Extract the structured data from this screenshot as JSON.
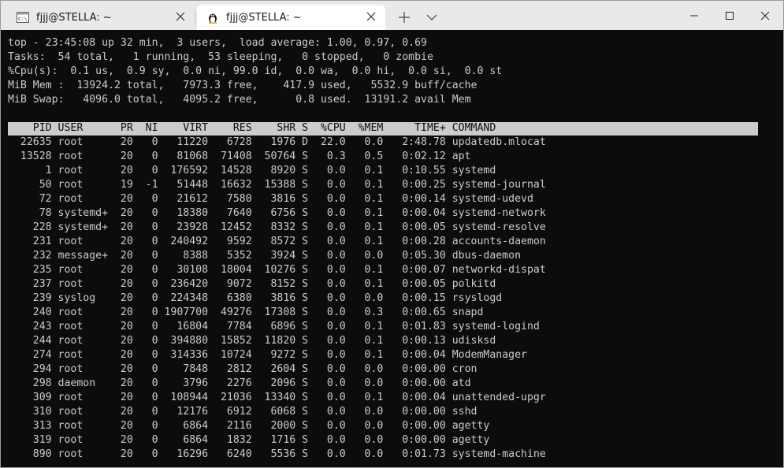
{
  "tabs": [
    {
      "title": "fjjj@STELLA: ~",
      "icon": "cmd-icon",
      "active": false
    },
    {
      "title": "fjjj@STELLA: ~",
      "icon": "linux-penguin-icon",
      "active": true
    }
  ],
  "window_controls": [
    "minimize-icon",
    "maximize-icon",
    "close-icon"
  ],
  "summary": [
    "top - 23:45:08 up 32 min,  3 users,  load average: 1.00, 0.97, 0.69",
    "Tasks:  54 total,   1 running,  53 sleeping,   0 stopped,   0 zombie",
    "%Cpu(s):  0.1 us,  0.9 sy,  0.0 ni, 99.0 id,  0.0 wa,  0.0 hi,  0.0 si,  0.0 st",
    "MiB Mem :  13924.2 total,   7973.3 free,    417.9 used,   5532.9 buff/cache",
    "MiB Swap:   4096.0 total,   4095.2 free,      0.8 used.  13191.2 avail Mem"
  ],
  "columns": [
    "PID",
    "USER",
    "PR",
    "NI",
    "VIRT",
    "RES",
    "SHR",
    "S",
    "%CPU",
    "%MEM",
    "TIME+",
    "COMMAND"
  ],
  "processes": [
    [
      "22635",
      "root",
      "20",
      "0",
      "11220",
      "6728",
      "1976",
      "D",
      "22.0",
      "0.0",
      "2:48.78",
      "updatedb.mlocat"
    ],
    [
      "13528",
      "root",
      "20",
      "0",
      "81068",
      "71408",
      "50764",
      "S",
      "0.3",
      "0.5",
      "0:02.12",
      "apt"
    ],
    [
      "1",
      "root",
      "20",
      "0",
      "176592",
      "14528",
      "8920",
      "S",
      "0.0",
      "0.1",
      "0:10.55",
      "systemd"
    ],
    [
      "50",
      "root",
      "19",
      "-1",
      "51448",
      "16632",
      "15388",
      "S",
      "0.0",
      "0.1",
      "0:00.25",
      "systemd-journal"
    ],
    [
      "72",
      "root",
      "20",
      "0",
      "21612",
      "7580",
      "3816",
      "S",
      "0.0",
      "0.1",
      "0:00.14",
      "systemd-udevd"
    ],
    [
      "78",
      "systemd+",
      "20",
      "0",
      "18380",
      "7640",
      "6756",
      "S",
      "0.0",
      "0.1",
      "0:00.04",
      "systemd-network"
    ],
    [
      "228",
      "systemd+",
      "20",
      "0",
      "23928",
      "12452",
      "8332",
      "S",
      "0.0",
      "0.1",
      "0:00.05",
      "systemd-resolve"
    ],
    [
      "231",
      "root",
      "20",
      "0",
      "240492",
      "9592",
      "8572",
      "S",
      "0.0",
      "0.1",
      "0:00.28",
      "accounts-daemon"
    ],
    [
      "232",
      "message+",
      "20",
      "0",
      "8388",
      "5352",
      "3924",
      "S",
      "0.0",
      "0.0",
      "0:05.30",
      "dbus-daemon"
    ],
    [
      "235",
      "root",
      "20",
      "0",
      "30108",
      "18004",
      "10276",
      "S",
      "0.0",
      "0.1",
      "0:00.07",
      "networkd-dispat"
    ],
    [
      "237",
      "root",
      "20",
      "0",
      "236420",
      "9072",
      "8152",
      "S",
      "0.0",
      "0.1",
      "0:00.05",
      "polkitd"
    ],
    [
      "239",
      "syslog",
      "20",
      "0",
      "224348",
      "6380",
      "3816",
      "S",
      "0.0",
      "0.0",
      "0:00.15",
      "rsyslogd"
    ],
    [
      "240",
      "root",
      "20",
      "0",
      "1907700",
      "49276",
      "17308",
      "S",
      "0.0",
      "0.3",
      "0:00.65",
      "snapd"
    ],
    [
      "243",
      "root",
      "20",
      "0",
      "16804",
      "7784",
      "6896",
      "S",
      "0.0",
      "0.1",
      "0:01.83",
      "systemd-logind"
    ],
    [
      "244",
      "root",
      "20",
      "0",
      "394880",
      "15852",
      "11820",
      "S",
      "0.0",
      "0.1",
      "0:00.13",
      "udisksd"
    ],
    [
      "274",
      "root",
      "20",
      "0",
      "314336",
      "10724",
      "9272",
      "S",
      "0.0",
      "0.1",
      "0:00.04",
      "ModemManager"
    ],
    [
      "294",
      "root",
      "20",
      "0",
      "7848",
      "2812",
      "2604",
      "S",
      "0.0",
      "0.0",
      "0:00.00",
      "cron"
    ],
    [
      "298",
      "daemon",
      "20",
      "0",
      "3796",
      "2276",
      "2096",
      "S",
      "0.0",
      "0.0",
      "0:00.00",
      "atd"
    ],
    [
      "309",
      "root",
      "20",
      "0",
      "108944",
      "21036",
      "13340",
      "S",
      "0.0",
      "0.1",
      "0:00.04",
      "unattended-upgr"
    ],
    [
      "310",
      "root",
      "20",
      "0",
      "12176",
      "6912",
      "6068",
      "S",
      "0.0",
      "0.0",
      "0:00.00",
      "sshd"
    ],
    [
      "313",
      "root",
      "20",
      "0",
      "6864",
      "2116",
      "2000",
      "S",
      "0.0",
      "0.0",
      "0:00.00",
      "agetty"
    ],
    [
      "319",
      "root",
      "20",
      "0",
      "6864",
      "1832",
      "1716",
      "S",
      "0.0",
      "0.0",
      "0:00.00",
      "agetty"
    ],
    [
      "890",
      "root",
      "20",
      "0",
      "16296",
      "6240",
      "5536",
      "S",
      "0.0",
      "0.0",
      "0:01.73",
      "systemd-machine"
    ]
  ],
  "colors": {
    "terminal_bg": "#0c0c0c",
    "terminal_fg": "#cccccc",
    "header_bg": "#cccccc",
    "titlebar_bg": "#e9e9e9",
    "active_tab_bg": "#ffffff"
  }
}
